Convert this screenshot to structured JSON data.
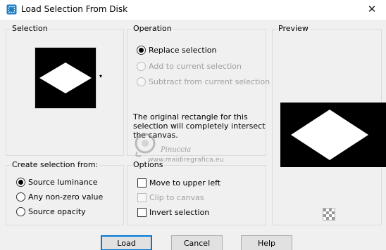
{
  "window": {
    "title": "Load Selection From Disk",
    "close_glyph": "✕"
  },
  "selection": {
    "group_label": "Selection",
    "dropdown_glyph": "▾"
  },
  "operation": {
    "group_label": "Operation",
    "options": [
      {
        "label": "Replace selection",
        "selected": true,
        "enabled": true
      },
      {
        "label": "Add to current selection",
        "selected": false,
        "enabled": false
      },
      {
        "label": "Subtract from current selection",
        "selected": false,
        "enabled": false
      }
    ],
    "info_text": "The original rectangle for this selection will completely intersect the canvas."
  },
  "preview": {
    "group_label": "Preview"
  },
  "create_from": {
    "group_label": "Create selection from:",
    "options": [
      {
        "label": "Source luminance",
        "selected": true
      },
      {
        "label": "Any non-zero value",
        "selected": false
      },
      {
        "label": "Source opacity",
        "selected": false
      }
    ]
  },
  "options": {
    "group_label": "Options",
    "items": [
      {
        "label": "Move to upper left",
        "checked": false,
        "enabled": true
      },
      {
        "label": "Clip to canvas",
        "checked": false,
        "enabled": false
      },
      {
        "label": "Invert selection",
        "checked": false,
        "enabled": true
      }
    ]
  },
  "watermark": {
    "name": "Pinuccia",
    "url": "www.maidiregrafica.eu"
  },
  "buttons": {
    "load": "Load",
    "cancel": "Cancel",
    "help": "Help"
  },
  "colors": {
    "accent": "#0078d7",
    "dialog_bg": "#f0f0f0",
    "disabled_text": "#a0a0a0"
  }
}
